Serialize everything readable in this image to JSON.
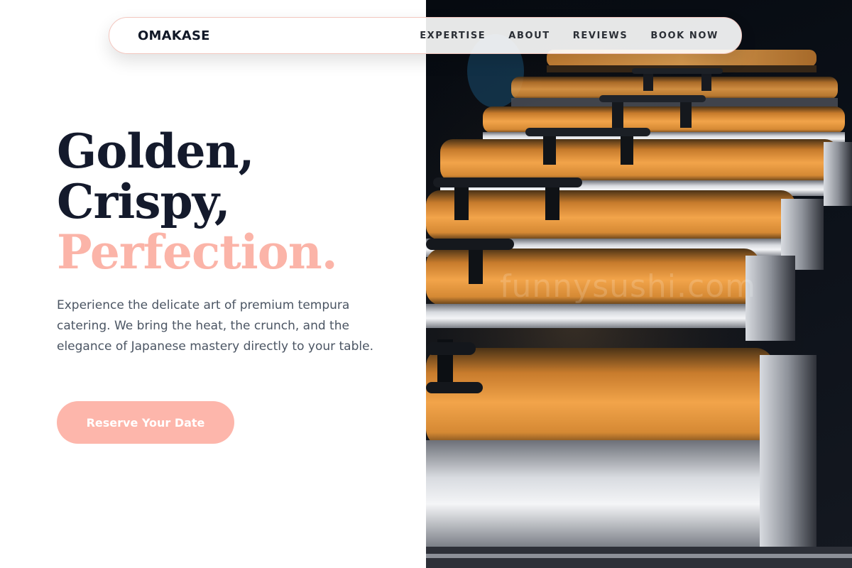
{
  "brand": {
    "name": "OMAKASE"
  },
  "nav": {
    "links": [
      "EXPERTISE",
      "ABOUT",
      "REVIEWS",
      "BOOK NOW"
    ]
  },
  "hero": {
    "line1": "Golden,",
    "line2": "Crispy,",
    "line3": "Perfection.",
    "description": "Experience the delicate art of premium tempura catering. We bring the heat, the crunch, and the elegance of Japanese mastery directly to your table.",
    "cta_label": "Reserve Your Date"
  },
  "photo": {
    "subject": "rows of stainless steel chafing dishes under warm light",
    "watermark": "funnysushi.com"
  },
  "colors": {
    "accent": "#fbb4a8",
    "heading": "#141a2c",
    "body_text": "#4b5563",
    "button": "#fdb6ab"
  }
}
